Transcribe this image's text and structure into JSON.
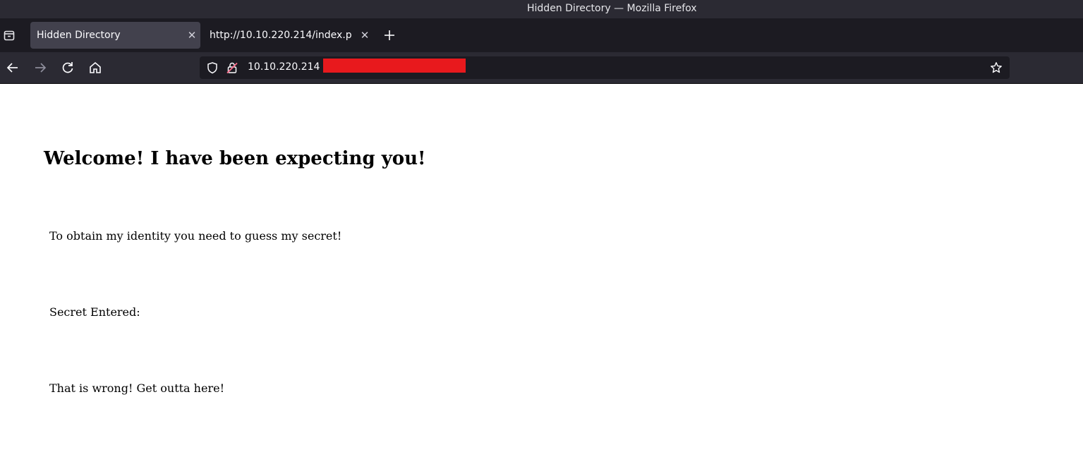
{
  "window": {
    "title": "Hidden Directory — Mozilla Firefox"
  },
  "tabs": [
    {
      "label": "Hidden Directory",
      "active": true
    },
    {
      "label": "http://10.10.220.214/index.p",
      "active": false
    }
  ],
  "icons": {
    "tab_list": "tab-list-icon",
    "close": "close-icon",
    "new_tab": "plus-icon",
    "back": "back-arrow-icon",
    "forward": "forward-arrow-icon",
    "reload": "reload-icon",
    "home": "home-icon",
    "shield": "shield-icon",
    "insecure_lock": "insecure-lock-icon",
    "bookmark": "star-icon"
  },
  "urlbar": {
    "url": "10.10.220.214"
  },
  "page": {
    "heading": "Welcome! I have been expecting you!",
    "line1": "To obtain my identity you need to guess my secret!",
    "line2": "Secret Entered:",
    "line3": "That is wrong! Get outta here!"
  },
  "colors": {
    "redaction": "#e8191d",
    "insecure_lock": "#ff6b8b"
  }
}
